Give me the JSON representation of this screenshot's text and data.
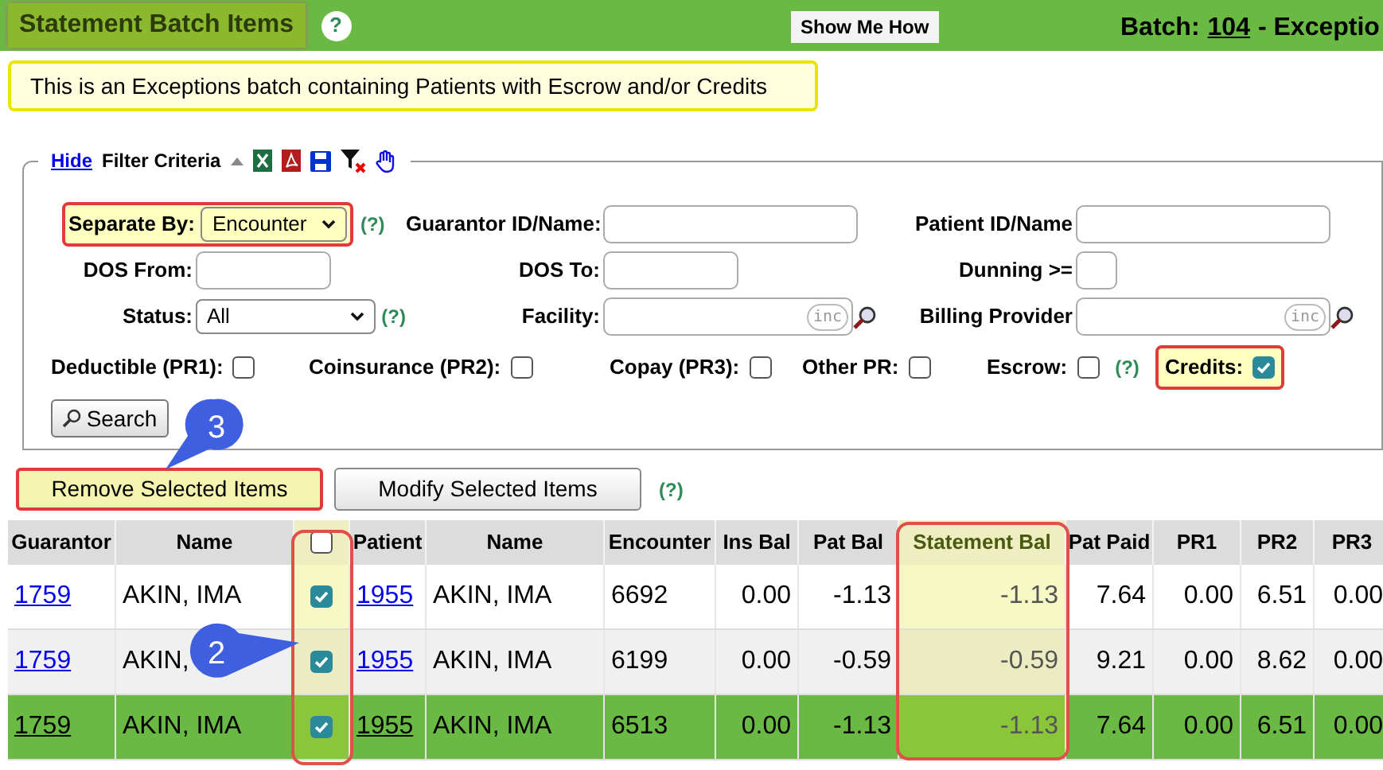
{
  "header": {
    "title": "Statement Batch Items",
    "help": "?",
    "show_me_how": "Show Me How",
    "batch_label": "Batch:",
    "batch_number": "104",
    "batch_suffix": "- Exceptio"
  },
  "notice": "This is an Exceptions batch containing Patients with Escrow and/or Credits",
  "filter": {
    "toggle": "Hide",
    "legend": "Filter Criteria",
    "expanded": true,
    "rows": [
      [
        {
          "label": "Separate By:",
          "kind": "select",
          "value": "Encounter",
          "help": "(?)",
          "highlighted": true
        },
        {
          "label": "Guarantor ID/Name:",
          "kind": "text"
        },
        {
          "label": "Patient ID/Name",
          "kind": "text"
        }
      ],
      [
        {
          "label": "DOS From:",
          "kind": "short"
        },
        {
          "label": "DOS To:",
          "kind": "short"
        },
        {
          "label": "Dunning >=",
          "kind": "tiny"
        }
      ],
      [
        {
          "label": "Status:",
          "kind": "select",
          "value": "All",
          "help": "(?)",
          "highlighted": false
        },
        {
          "label": "Facility:",
          "kind": "lookup",
          "badge": "inc"
        },
        {
          "label": "Billing Provider",
          "kind": "lookup",
          "badge": "inc"
        }
      ]
    ],
    "checkboxes": [
      {
        "label": "Deductible (PR1):",
        "checked": false,
        "highlighted": false
      },
      {
        "label": "Coinsurance (PR2):",
        "checked": false,
        "highlighted": false
      },
      {
        "label": "Copay (PR3):",
        "checked": false,
        "highlighted": false
      },
      {
        "label": "Other PR:",
        "checked": false,
        "highlighted": false
      },
      {
        "label": "Escrow:",
        "checked": false,
        "highlighted": false,
        "help": "(?)"
      },
      {
        "label": "Credits:",
        "checked": true,
        "highlighted": true
      }
    ],
    "search": "Search"
  },
  "actions": [
    {
      "label": "Remove Selected Items",
      "highlighted": true
    },
    {
      "label": "Modify Selected Items",
      "highlighted": false
    }
  ],
  "actions_help": "(?)",
  "table": {
    "header_checked": false,
    "columns": [
      {
        "label": "Guarantor",
        "kind": "link",
        "highlighted": false
      },
      {
        "label": "Name",
        "kind": "text",
        "highlighted": false
      },
      {
        "kind": "check",
        "highlighted": true
      },
      {
        "label": "Patient",
        "kind": "link",
        "highlighted": false
      },
      {
        "label": "Name",
        "kind": "text",
        "highlighted": false
      },
      {
        "label": "Encounter",
        "kind": "text",
        "highlighted": false
      },
      {
        "label": "Ins Bal",
        "kind": "num",
        "highlighted": false
      },
      {
        "label": "Pat Bal",
        "kind": "num",
        "highlighted": false
      },
      {
        "label": "Statement Bal",
        "kind": "num",
        "highlighted": true
      },
      {
        "label": "Pat Paid",
        "kind": "num",
        "highlighted": false
      },
      {
        "label": "PR1",
        "kind": "num",
        "highlighted": false
      },
      {
        "label": "PR2",
        "kind": "num",
        "highlighted": false
      },
      {
        "label": "PR3",
        "kind": "num",
        "highlighted": false
      }
    ],
    "rows": [
      {
        "selected": false,
        "checked": true,
        "cells": [
          "1759",
          "AKIN, IMA",
          "",
          "1955",
          "AKIN, IMA",
          "6692",
          "0.00",
          "-1.13",
          "-1.13",
          "7.64",
          "0.00",
          "6.51",
          "0.00"
        ]
      },
      {
        "selected": false,
        "checked": true,
        "cells": [
          "1759",
          "AKIN,",
          "",
          "1955",
          "AKIN, IMA",
          "6199",
          "0.00",
          "-0.59",
          "-0.59",
          "9.21",
          "0.00",
          "8.62",
          "0.00"
        ]
      },
      {
        "selected": true,
        "checked": true,
        "cells": [
          "1759",
          "AKIN, IMA",
          "",
          "1955",
          "AKIN, IMA",
          "6513",
          "0.00",
          "-1.13",
          "-1.13",
          "7.64",
          "0.00",
          "6.51",
          "0.00"
        ]
      }
    ]
  },
  "callouts": [
    {
      "label": "3",
      "kind": "down"
    },
    {
      "label": "2",
      "kind": "right"
    }
  ]
}
